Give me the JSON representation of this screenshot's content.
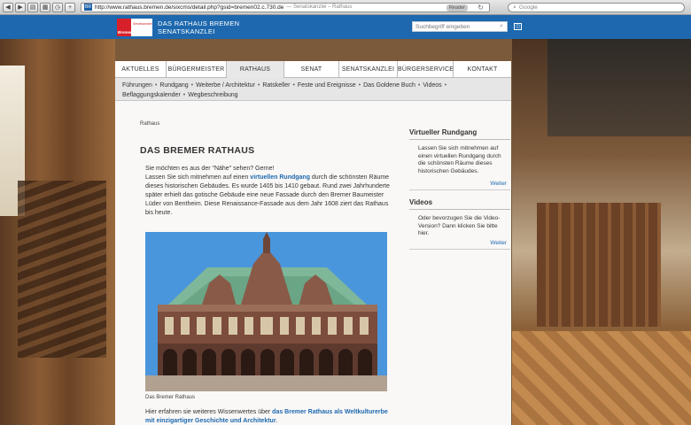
{
  "browser": {
    "url": "http://www.rathaus.bremen.de/sixcms/detail.php?gsid=bremen02.c.730.de",
    "page_title": "— Senatskanzlei – Rathaus",
    "reader_label": "Reader",
    "search_placeholder": "Google",
    "site_badge": "BR"
  },
  "header": {
    "logo_text": "Bremen",
    "logo_tagline": "Senatskanzlei",
    "title_line1": "DAS RATHAUS BREMEN",
    "title_line2": "SENATSKANZLEI",
    "search_placeholder": "Suchbegriff eingeben",
    "brand_color": "#1d68ae",
    "logo_color": "#d8202a"
  },
  "main_nav": [
    {
      "label": "AKTUELLES",
      "active": false
    },
    {
      "label": "BÜRGERMEISTER",
      "active": false
    },
    {
      "label": "RATHAUS",
      "active": true
    },
    {
      "label": "SENAT",
      "active": false
    },
    {
      "label": "SENATSKANZLEI",
      "active": false
    },
    {
      "label": "BÜRGERSERVICE",
      "active": false
    },
    {
      "label": "KONTAKT",
      "active": false
    }
  ],
  "sub_nav": {
    "row1": [
      "Führungen",
      "Rundgang",
      "Weiterbe / Architektur",
      "Ratskeller",
      "Feste und Ereignisse",
      "Das Goldene Buch",
      "Videos"
    ],
    "row2": [
      "Beflaggungskalender",
      "Wegbeschreibung"
    ]
  },
  "breadcrumb": "Rathaus",
  "page_title": "DAS BREMER RATHAUS",
  "intro": {
    "line1": "Sie möchten es aus der \"Nähe\" sehen? Gerne!",
    "p_before": "Lassen Sie sich mitnehmen auf einen ",
    "p_link": "virtuellen Rundgang",
    "p_after": " durch die schönsten Räume dieses historischen Gebäudes. Es wurde 1405 bis 1410 gebaut. Rund zwei Jahrhunderte später erhielt das gotische Gebäude eine neue Fassade durch den Bremer Baumeister Lüder von Bentheim. Diese Renaissance-Fassade aus dem Jahr 1608 ziert das Rathaus bis heute."
  },
  "photo_caption": "Das Bremer Rathaus",
  "bottom": {
    "before": "Hier erfahren sie weiteres Wissenwertes über ",
    "link": "das Bremer Rathaus als Weltkulturerbe mit einzigartiger Geschichte und Architektur",
    "after": "."
  },
  "sidebar": [
    {
      "title": "Virtueller Rundgang",
      "text": "Lassen Sie sich mitnehmen auf einen virtuellen Rundgang durch die schönsten Räume dieses historischen Gebäudes.",
      "more": "Weiter"
    },
    {
      "title": "Videos",
      "text": "Oder bevorzugen Sie die Video-Version? Dann klicken Sie bitte hier.",
      "more": "Weiter"
    }
  ]
}
